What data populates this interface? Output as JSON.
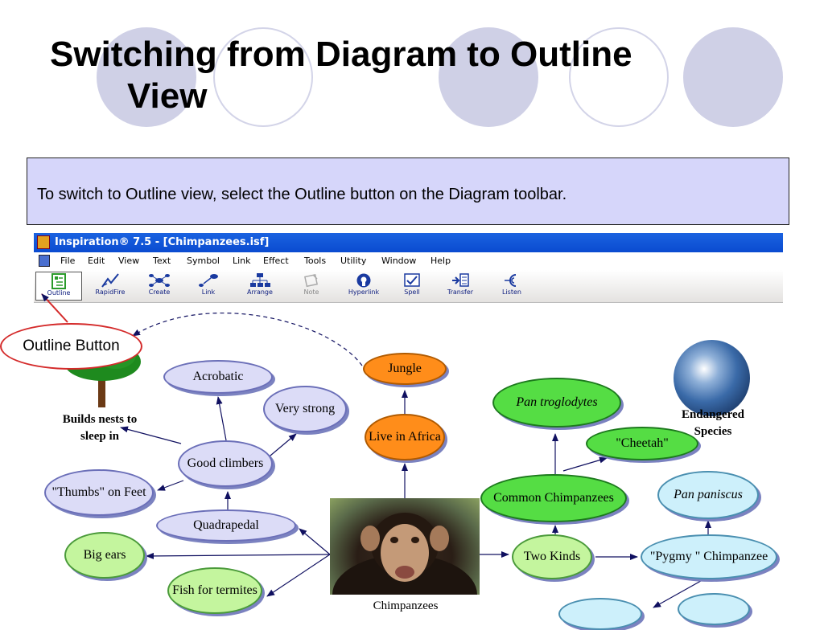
{
  "slide": {
    "title_line1": "Switching from Diagram to Outline",
    "title_line2": "View",
    "instruction": "To switch to Outline view, select the Outline button on the Diagram toolbar."
  },
  "app": {
    "title": "Inspiration® 7.5 - [Chimpanzees.isf]",
    "menu": [
      "File",
      "Edit",
      "View",
      "Text",
      "Symbol",
      "Link",
      "Effect",
      "Tools",
      "Utility",
      "Window",
      "Help"
    ],
    "toolbar": [
      {
        "label": "Outline",
        "icon": "outline-icon",
        "active": true
      },
      {
        "label": "RapidFire",
        "icon": "rapidfire-icon"
      },
      {
        "label": "Create",
        "icon": "create-icon"
      },
      {
        "label": "Link",
        "icon": "link-icon"
      },
      {
        "label": "Arrange",
        "icon": "arrange-icon"
      },
      {
        "label": "Note",
        "icon": "note-icon",
        "disabled": true
      },
      {
        "label": "Hyperlink",
        "icon": "hyperlink-icon"
      },
      {
        "label": "Spell",
        "icon": "spell-icon"
      },
      {
        "label": "Transfer",
        "icon": "transfer-icon"
      },
      {
        "label": "Listen",
        "icon": "listen-icon"
      }
    ]
  },
  "callout": "Outline Button",
  "diagram": {
    "center_caption": "Chimpanzees",
    "nodes": {
      "jungle": "Jungle",
      "live_in_africa": "Live in Africa",
      "acrobatic": "Acrobatic",
      "very_strong": "Very strong",
      "good_climbers": "Good climbers",
      "thumbs_on_feet": "\"Thumbs\" on Feet",
      "quadrapedal": "Quadrapedal",
      "big_ears": "Big ears",
      "fish_for_termites": "Fish for termites",
      "pan_troglodytes": "Pan troglodytes",
      "cheetah": "\"Cheetah\"",
      "common_chimpanzees": "Common Chimpanzees",
      "two_kinds": "Two Kinds",
      "pan_paniscus": "Pan paniscus",
      "pygmy_chimpanzee": "\"Pygmy \" Chimpanzee"
    },
    "tree_caption": "Builds nests to sleep in",
    "earth_caption": "Endangered Species"
  },
  "colors": {
    "instruction_bg": "#d6d6fa",
    "title_bar": "#0a4bd0",
    "callout_border": "#d42a2a",
    "node_green": "#55dd44",
    "node_orange": "#ff8d1a",
    "node_lavender": "#dcdcf7",
    "node_lightgreen": "#c4f59e",
    "node_lightblue": "#cdf0fb"
  }
}
